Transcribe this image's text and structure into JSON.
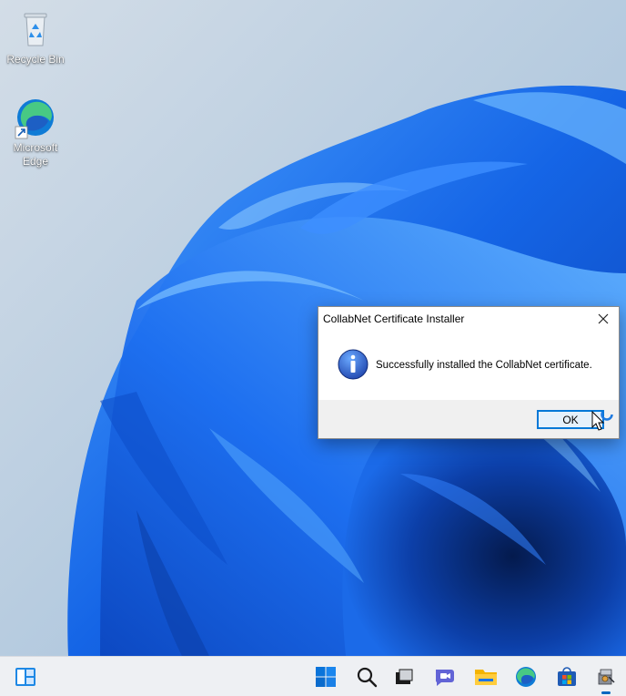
{
  "desktop": {
    "icons": [
      {
        "label": "Recycle Bin",
        "icon": "recycle-bin-icon"
      },
      {
        "label": "Microsoft Edge",
        "icon": "edge-icon"
      }
    ]
  },
  "dialog": {
    "title": "CollabNet Certificate Installer",
    "message": "Successfully installed the CollabNet certificate.",
    "ok_label": "OK",
    "close_glyph": "✕",
    "icon": "info-icon"
  },
  "taskbar": {
    "items": [
      {
        "name": "widgets",
        "icon": "widgets-icon"
      },
      {
        "name": "start",
        "icon": "windows-start-icon"
      },
      {
        "name": "search",
        "icon": "search-icon"
      },
      {
        "name": "task-view",
        "icon": "task-view-icon"
      },
      {
        "name": "chat",
        "icon": "chat-icon"
      },
      {
        "name": "file-explorer",
        "icon": "folder-icon"
      },
      {
        "name": "edge",
        "icon": "edge-icon"
      },
      {
        "name": "store",
        "icon": "store-icon"
      },
      {
        "name": "installer",
        "icon": "installer-icon"
      }
    ],
    "accent_color": "#0067c0"
  },
  "colors": {
    "dialog_button_border": "#0078d7",
    "wallpaper_blue": "#1a73e8"
  }
}
